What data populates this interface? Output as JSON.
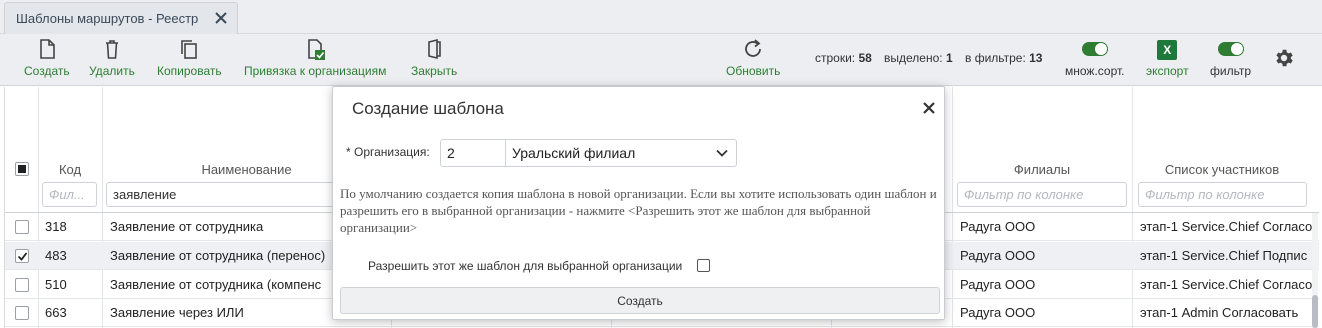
{
  "tab": {
    "title": "Шаблоны маршрутов - Реестр"
  },
  "toolbar": {
    "create": "Создать",
    "delete": "Удалить",
    "copy": "Копировать",
    "bind_org": "Привязка к организациям",
    "close": "Закрыть",
    "refresh": "Обновить",
    "rows_label": "строки:",
    "rows_count": "58",
    "selected_label": "выделено:",
    "selected_count": "1",
    "filter_label": "в фильтре:",
    "filter_count": "13",
    "multisort": "множ.сорт.",
    "export": "экспорт",
    "excel_letter": "X",
    "filter_toggle": "фильтр",
    "accent_color": "#2e7d32"
  },
  "grid": {
    "columns": {
      "code": "Код",
      "name": "Наименование",
      "branches": "Филиалы",
      "participants": "Список участников"
    },
    "filters": {
      "code_placeholder": "Фил...",
      "name_value": "заявление",
      "branches_placeholder": "Фильтр по колонке",
      "participants_placeholder": "Фильтр по колонке"
    },
    "rows": [
      {
        "checked": false,
        "code": "318",
        "name": "Заявление от сотрудника",
        "branch": "Радуга ООО",
        "participants": "этап-1 Service.Chief Согласо"
      },
      {
        "checked": true,
        "code": "483",
        "name": "Заявление от сотрудника (перенос)",
        "branch": "Радуга ООО",
        "participants": "этап-1 Service.Chief Подпис"
      },
      {
        "checked": false,
        "code": "510",
        "name": "Заявление от сотрудника (компенс",
        "branch": "Радуга ООО",
        "participants": "этап-1 Service.Chief Согласо"
      },
      {
        "checked": false,
        "code": "663",
        "name": "Заявление через ИЛИ",
        "branch": "Радуга ООО",
        "participants": "этап-1 Admin Согласовать"
      }
    ]
  },
  "modal": {
    "title": "Создание шаблона",
    "org_label": "* Организация:",
    "org_code": "2",
    "org_name": "Уральский филиал",
    "info_text": "По умолчанию создается копия шаблона в новой организации. Если вы хотите использовать один шаблон и разрешить его в выбранной организации - нажмите <Разрешить этот же шаблон для выбранной организации>",
    "allow_label": "Разрешить этот же шаблон для выбранной организации",
    "allow_checked": false,
    "create_button": "Создать"
  }
}
